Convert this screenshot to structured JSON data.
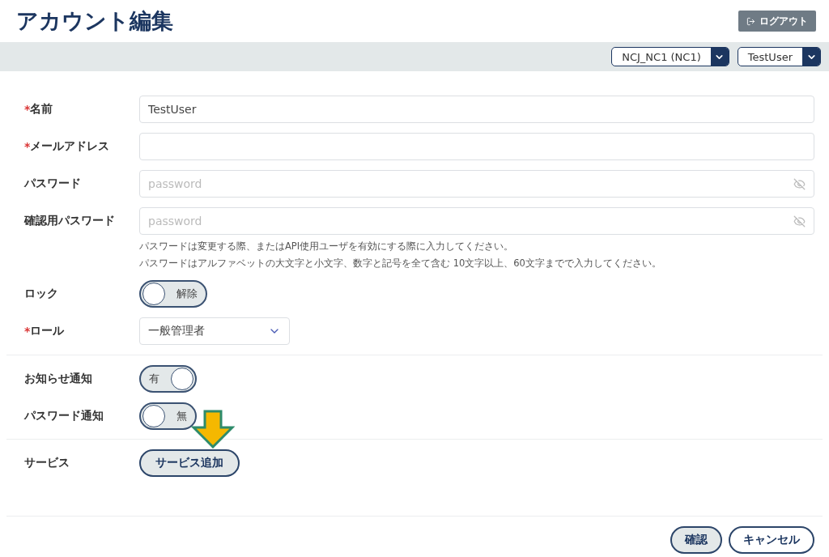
{
  "page_title": "アカウント編集",
  "logout_button": "ログアウト",
  "header_selects": [
    {
      "value": "NCJ_NC1 (NC1)"
    },
    {
      "value": "TestUser"
    }
  ],
  "fields": [
    {
      "required_mark": "*",
      "label": "名前",
      "value": "TestUser",
      "kind": "text"
    },
    {
      "required_mark": "*",
      "label": "メールアドレス",
      "kind": "text"
    },
    {
      "label": "パスワード",
      "placeholder": "password",
      "kind": "password"
    },
    {
      "label": "確認用パスワード",
      "placeholder": "password",
      "kind": "password"
    }
  ],
  "password_hints": [
    "パスワードは変更する際、またはAPI使用ユーザを有効にする際に入力してください。",
    "パスワードはアルファベットの大文字と小文字、数字と記号を全て含む 10文字以上、60文字までで入力してください。"
  ],
  "lock": {
    "label": "ロック",
    "on": false,
    "state_text": "解除"
  },
  "role": {
    "required_mark": "*",
    "label": "ロール",
    "value": "一般管理者"
  },
  "notifications": [
    {
      "label": "お知らせ通知",
      "on": true,
      "state_text": "有"
    },
    {
      "label": "パスワード通知",
      "on": false,
      "state_text": "無"
    }
  ],
  "service": {
    "label": "サービス",
    "button": "サービス追加"
  },
  "footer_buttons": [
    {
      "label": "確認",
      "kind": "primary"
    },
    {
      "label": "キャンセル",
      "kind": "secondary"
    }
  ]
}
